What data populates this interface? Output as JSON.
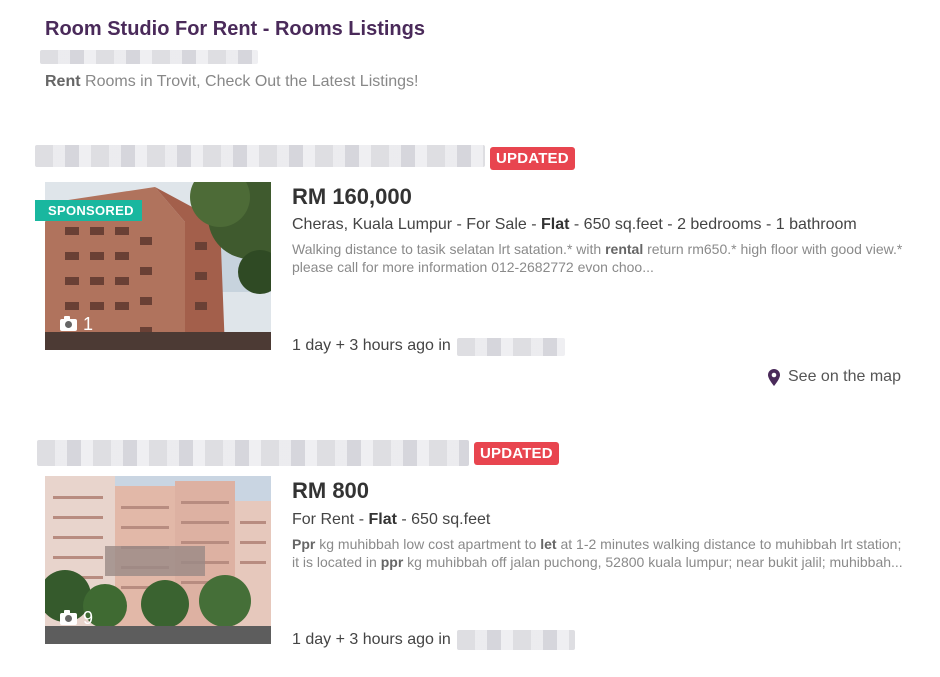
{
  "page": {
    "title": "Room Studio For Rent - Rooms Listings",
    "intro_bold": "Rent",
    "intro_rest": " Rooms in Trovit, Check Out the Latest Listings!"
  },
  "listings": [
    {
      "badge": "UPDATED",
      "sponsored_label": "SPONSORED",
      "photo_count": "1",
      "price": "RM 160,000",
      "location": "Cheras, Kuala Lumpur - For Sale - ",
      "type": "Flat",
      "details": " - 650 sq.feet - 2 bedrooms - 1 bathroom",
      "desc_a": "Walking distance to tasik selatan lrt satation.* with ",
      "desc_b": "rental",
      "desc_c": " return rm650.* high floor with good view.* please call for more information 012-2682772 evon choo...",
      "ago": "1 day + 3 hours ago in",
      "map_label": "See on the map"
    },
    {
      "badge": "UPDATED",
      "photo_count": "9",
      "price": "RM 800",
      "location": "For Rent - ",
      "type": "Flat",
      "details": " - 650 sq.feet",
      "desc_1": "Ppr",
      "desc_2": " kg muhibbah low cost apartment to ",
      "desc_3": "let",
      "desc_4": " at 1-2 minutes walking distance to muhibbah lrt station; it is located in ",
      "desc_5": "ppr",
      "desc_6": " kg muhibbah off jalan puchong, 52800 kuala lumpur; near bukit jalil; muhibbah...",
      "ago": "1 day + 3 hours ago in"
    }
  ],
  "colors": {
    "title": "#4a2a5a",
    "badge_updated": "#e8454f",
    "sponsored": "#19b79f"
  },
  "icons": [
    "camera-icon",
    "map-pin-icon"
  ]
}
